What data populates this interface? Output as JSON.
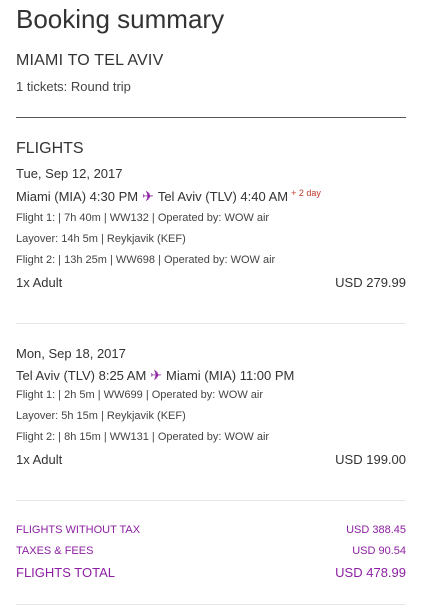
{
  "header": {
    "title": "Booking summary",
    "route": "MIAMI TO TEL AVIV",
    "tickets": "1 tickets: Round trip"
  },
  "flights_heading": "FLIGHTS",
  "plane_icon": "plane-icon",
  "accent_color": "#8d1fa2",
  "legs": [
    {
      "date": "Tue, Sep 12, 2017",
      "origin": "Miami (MIA) 4:30 PM",
      "destination": "Tel Aviv (TLV) 4:40 AM",
      "day_offset": "+ 2 day",
      "details": [
        "Flight 1: | 7h 40m | WW132 | Operated by: WOW air",
        "Layover: 14h 5m | Reykjavik (KEF)",
        "Flight 2: | 13h 25m | WW698 | Operated by: WOW air"
      ],
      "passengers": "1x Adult",
      "price": "USD 279.99"
    },
    {
      "date": "Mon, Sep 18, 2017",
      "origin": "Tel Aviv (TLV) 8:25 AM",
      "destination": "Miami (MIA) 11:00 PM",
      "details": [
        "Flight 1: | 2h 5m | WW699 | Operated by: WOW air",
        "Layover: 5h 15m | Reykjavik (KEF)",
        "Flight 2: | 8h 15m | WW131 | Operated by: WOW air"
      ],
      "passengers": "1x Adult",
      "price": "USD 199.00"
    }
  ],
  "summary": {
    "without_tax_label": "FLIGHTS WITHOUT TAX",
    "without_tax_value": "USD 388.45",
    "taxes_label": "TAXES & FEES",
    "taxes_value": "USD 90.54",
    "total_label": "FLIGHTS TOTAL",
    "total_value": "USD 478.99"
  }
}
